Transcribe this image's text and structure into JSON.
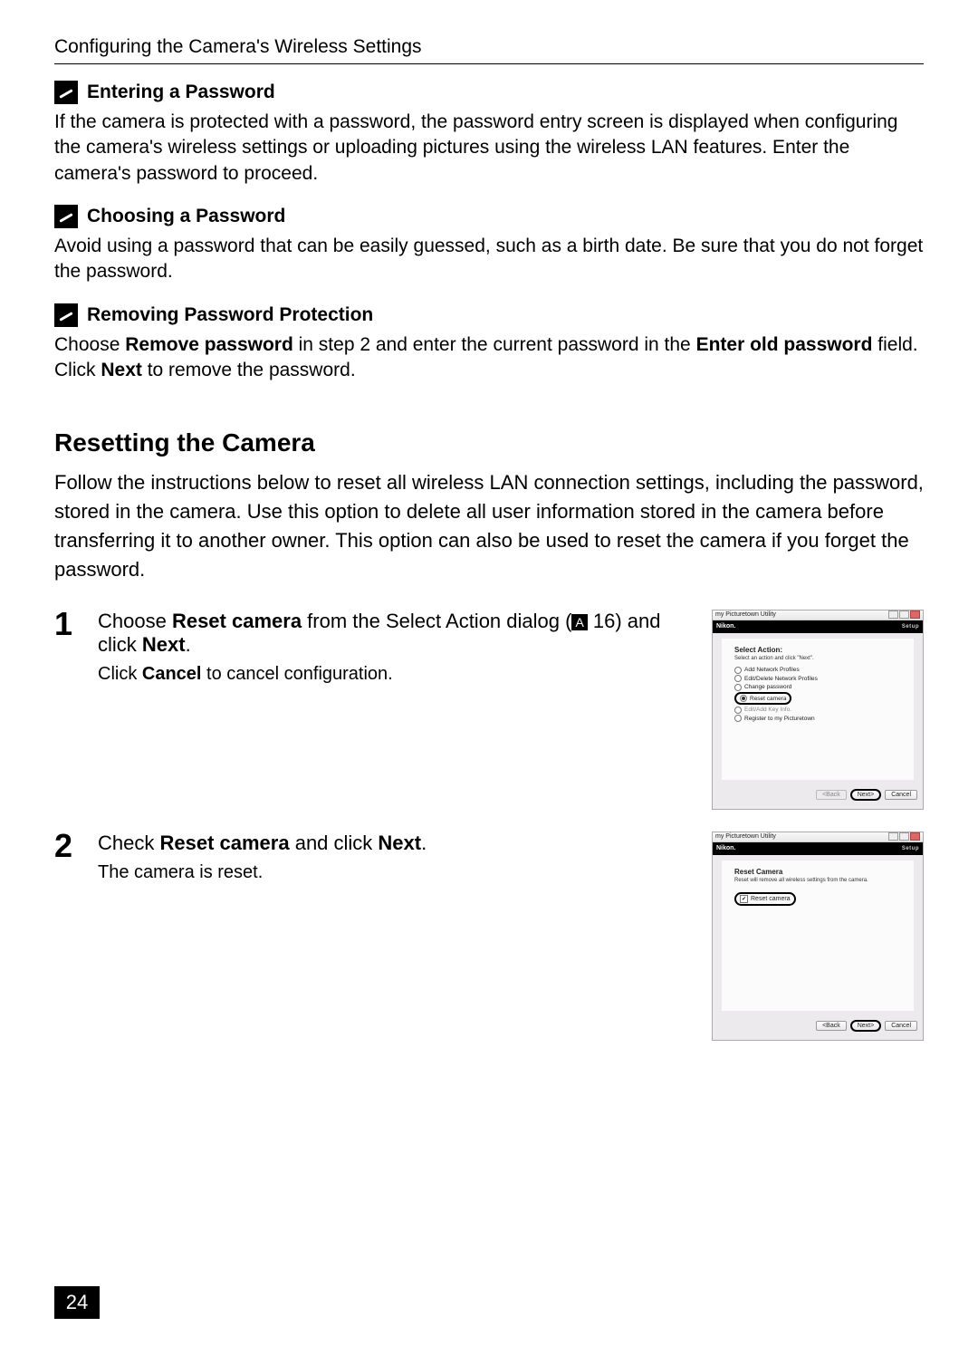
{
  "header": {
    "title": "Configuring the Camera's Wireless Settings"
  },
  "notes": {
    "n1": {
      "title": "Entering a Password",
      "body_pre": "If the camera is protected with a password, the password entry screen is displayed when configuring the camera's wireless settings or uploading pictures using the wireless LAN features. Enter the camera's password to proceed."
    },
    "n2": {
      "title": "Choosing a Password",
      "body": "Avoid using a password that can be easily guessed, such as a birth date. Be sure that you do not forget the password."
    },
    "n3": {
      "title": "Removing Password Protection",
      "body_1": "Choose ",
      "body_b1": "Remove password",
      "body_2": " in step 2 and enter the current password in the ",
      "body_b2": "Enter old password",
      "body_3": " field. Click ",
      "body_b3": "Next",
      "body_4": " to remove the password."
    }
  },
  "section": {
    "heading": "Resetting the Camera",
    "intro": "Follow the instructions below to reset all wireless LAN connection settings, including the password, stored in the camera. Use this option to delete all user information stored in the camera before transferring it to another owner. This option can also be used to reset the camera if you forget the password."
  },
  "step1": {
    "num": "1",
    "line_a": "Choose ",
    "line_b": "Reset camera",
    "line_c": " from the Select Action dialog (",
    "ref": "A",
    "refnum": " 16) and click ",
    "line_d": "Next",
    "line_e": ".",
    "sub_a": "Click ",
    "sub_b": "Cancel",
    "sub_c": " to cancel configuration."
  },
  "step2": {
    "num": "2",
    "line_a": "Check ",
    "line_b": "Reset camera",
    "line_c": " and click ",
    "line_d": "Next",
    "line_e": ".",
    "sub": "The camera is reset."
  },
  "dialog": {
    "window_title": "my Picturetown Utility",
    "brand": "Nikon.",
    "setup_label": "Setup",
    "select_action": {
      "heading": "Select Action:",
      "sub": "Select an action and click \"Next\".",
      "options": {
        "o1": "Add Network Profiles",
        "o2": "Edit/Delete Network Profiles",
        "o3": "Change password",
        "o4": "Reset camera",
        "o5": "Edit/Add Key Info.",
        "o6": "Register to my Picturetown"
      }
    },
    "reset_camera": {
      "heading": "Reset Camera",
      "sub": "Reset will remove all wireless settings from the camera.",
      "chk": "Reset camera"
    },
    "buttons": {
      "back": "<Back",
      "next": "Next>",
      "cancel": "Cancel"
    }
  },
  "page_number": "24"
}
